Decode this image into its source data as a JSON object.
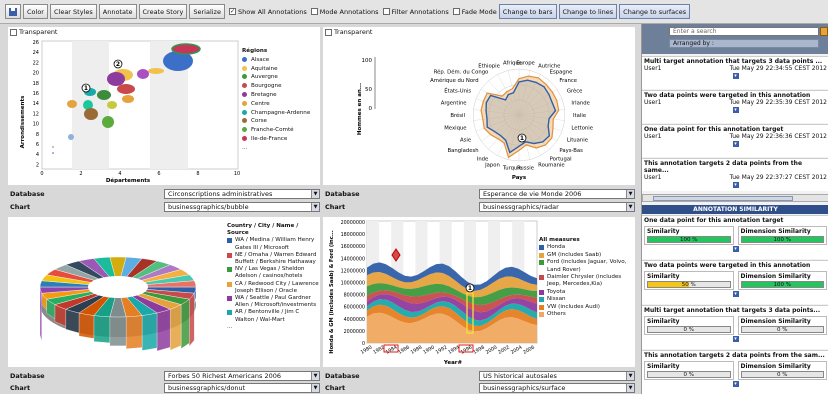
{
  "toolbar": {
    "color": "Color",
    "clear_styles": "Clear Styles",
    "annotate": "Annotate",
    "create_story": "Create Story",
    "serialize": "Serialize",
    "show_all": "Show All Annotations",
    "mode": "Mode Annotations",
    "filter": "Filter Annotations",
    "fade": "Fade Mode",
    "to_bars": "Change to bars",
    "to_lines": "Change to lines",
    "to_surfaces": "Change to surfaces"
  },
  "transparent_label": "Transparent",
  "field_labels": {
    "database": "Database",
    "chart": "Chart"
  },
  "panels": {
    "bubble": {
      "database": "Circonscriptions administratives",
      "chart": "businessgraphics/bubble",
      "ylabel": "Arrondissements",
      "xlabel": "Départements",
      "legend_title": "Régions",
      "legend": [
        "Alsace",
        "Aquitaine",
        "Auvergne",
        "Bourgogne",
        "Bretagne",
        "Centre",
        "Champagne-Ardenne",
        "Corse",
        "Franche-Comté",
        "Ile-de-France"
      ],
      "legend_more": "...",
      "y_ticks": [
        "26",
        "24",
        "22",
        "20",
        "18",
        "16",
        "14",
        "12",
        "10",
        "8",
        "6",
        "4",
        "2"
      ],
      "x_ticks": [
        "0",
        "2",
        "4",
        "6",
        "8",
        "10"
      ],
      "markers": [
        "1",
        "2"
      ]
    },
    "radar": {
      "database": "Esperance de vie Monde 2006",
      "chart": "businessgraphics/radar",
      "ylabel": "Hommes en an...",
      "xlabel": "Pays",
      "ticks": [
        "100",
        "50",
        "0"
      ],
      "countries": [
        "Europe",
        "Autriche",
        "Espagne",
        "France",
        "Grèce",
        "Irlande",
        "Italie",
        "Lettonie",
        "Lituanie",
        "Pays-Bas",
        "Portugal",
        "Roumanie",
        "Russie",
        "Turquie",
        "Japon",
        "Inde",
        "Bangladesh",
        "Asie",
        "Mexique",
        "Brésil",
        "Argentine",
        "États-Unis",
        "Amérique du Nord",
        "Rép. Dém. du Congo",
        "Ethiopie",
        "Afrique"
      ],
      "markers": [
        "1"
      ]
    },
    "donut": {
      "database": "Forbes 50 Richest Americans 2006",
      "chart": "businessgraphics/donut",
      "legend_title": "Country / City / Name / Source",
      "legend": [
        "WA / Medina / William Henry Gates III / Microsoft",
        "NE / Omaha / Warren Edward Buffett / Berkshire Hathaway",
        "NV / Las Vegas / Sheldon Adelson / casinos/hotels",
        "CA / Redwood City / Lawrence Joseph Ellison / Oracle",
        "WA / Seattle / Paul Gardner Allen / Microsoft/investments",
        "AR / Bentonville / Jim C Walton / Wal-Mart"
      ],
      "legend_more": "..."
    },
    "surface": {
      "database": "US historical autosales",
      "chart": "businessgraphics/surface",
      "ylabel": "Honda & GM (includes Saab) & Ford (inc...",
      "xlabel": "Year#",
      "y_ticks": [
        "20000000",
        "18000000",
        "16000000",
        "14000000",
        "12000000",
        "10000000",
        "8000000",
        "6000000",
        "4000000",
        "2000000",
        "0"
      ],
      "x_ticks": [
        "1980",
        "1982",
        "1984",
        "1986",
        "1988",
        "1990",
        "1992",
        "1994",
        "1996",
        "1998",
        "2000",
        "2002",
        "2004",
        "2006"
      ],
      "legend_title": "All measures",
      "legend": [
        "Honda",
        "GM (includes Saab)",
        "Ford (includes Jaguar, Volvo, Land Rover)",
        "Daimler Chrysler (includes Jeep, Mercedes,Kia)",
        "Toyota",
        "Nissan",
        "VW (includes Audi)",
        "Others"
      ],
      "markers": [
        "1"
      ]
    }
  },
  "right_panel": {
    "search_placeholder": "Enter a search",
    "arranged_by": "Arranged by :",
    "annotations": [
      {
        "title": "Multi target annotation that targets 3 data points ...",
        "user": "User1",
        "date": "Tue May 29 22:34:55 CEST 2012"
      },
      {
        "title": "Two data points were targeted in this annotation",
        "user": "User1",
        "date": "Tue May 29 22:35:39 CEST 2012"
      },
      {
        "title": "One data point for this annotation target",
        "user": "User1",
        "date": "Tue May 29 22:36:36 CEST 2012"
      },
      {
        "title": "This annotation targets 2 data points from the same...",
        "user": "User1",
        "date": "Tue May 29 22:37:27 CEST 2012"
      }
    ],
    "similarity_header": "ANNOTATION SIMILARITY",
    "sim_labels": {
      "similarity": "Similarity",
      "dimension": "Dimension Similarity"
    },
    "similarities": [
      {
        "title": "One data point for this annotation target",
        "similarity": "100 %",
        "dimension": "100 %"
      },
      {
        "title": "Two data points were targeted in this annotation",
        "similarity": "50 %",
        "dimension": "100 %"
      },
      {
        "title": "Multi target annotation that targets 3 data points...",
        "similarity": "0 %",
        "dimension": "0 %"
      },
      {
        "title": "This annotation targets 2 data points from the sam...",
        "similarity": "0 %",
        "dimension": "0 %"
      }
    ],
    "similarity_levels": [
      {
        "sim": 1,
        "dim": 1
      },
      {
        "sim": 0.5,
        "dim": 1
      },
      {
        "sim": 0,
        "dim": 0
      },
      {
        "sim": 0,
        "dim": 0
      }
    ]
  },
  "colors": {
    "accent": "#3b5998",
    "green": "#22c55e",
    "yellow": "#f5c518"
  }
}
